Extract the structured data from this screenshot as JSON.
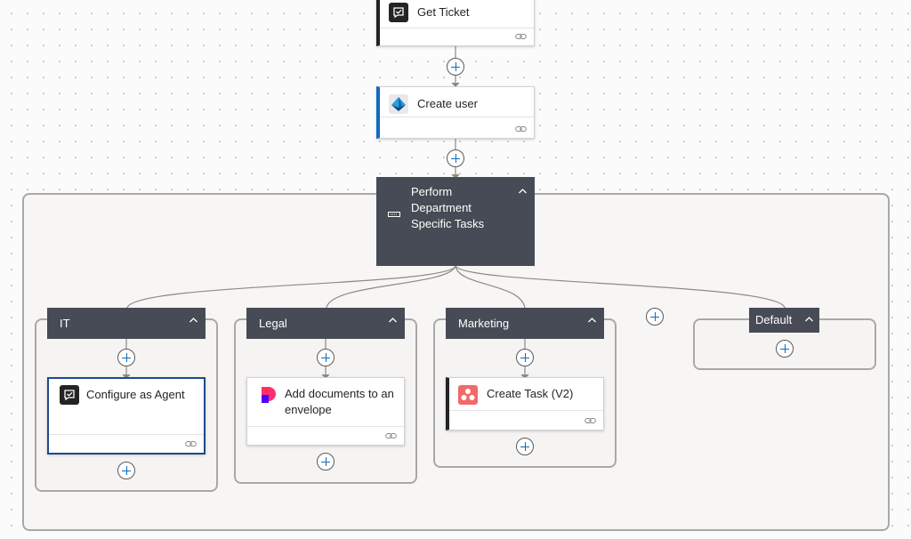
{
  "canvas": {
    "get_ticket": {
      "title": "Get Ticket",
      "icon": "approval-chat-icon"
    },
    "create_user": {
      "title": "Create user",
      "icon": "azure-ad-icon"
    },
    "switch": {
      "title": "Perform Department Specific Tasks",
      "icon": "switch-icon",
      "cases": [
        {
          "label": "IT",
          "action": {
            "title": "Configure as Agent",
            "icon": "approval-chat-icon"
          }
        },
        {
          "label": "Legal",
          "action": {
            "title": "Add documents to an envelope",
            "icon": "docusign-icon"
          }
        },
        {
          "label": "Marketing",
          "action": {
            "title": "Create Task (V2)",
            "icon": "asana-icon"
          }
        },
        {
          "label": "Default"
        }
      ]
    }
  },
  "colors": {
    "header_bg": "#474b55",
    "accent_blue": "#0f6cbd",
    "selected_border": "#1e4a8c",
    "asana_red": "#f06a6a"
  }
}
